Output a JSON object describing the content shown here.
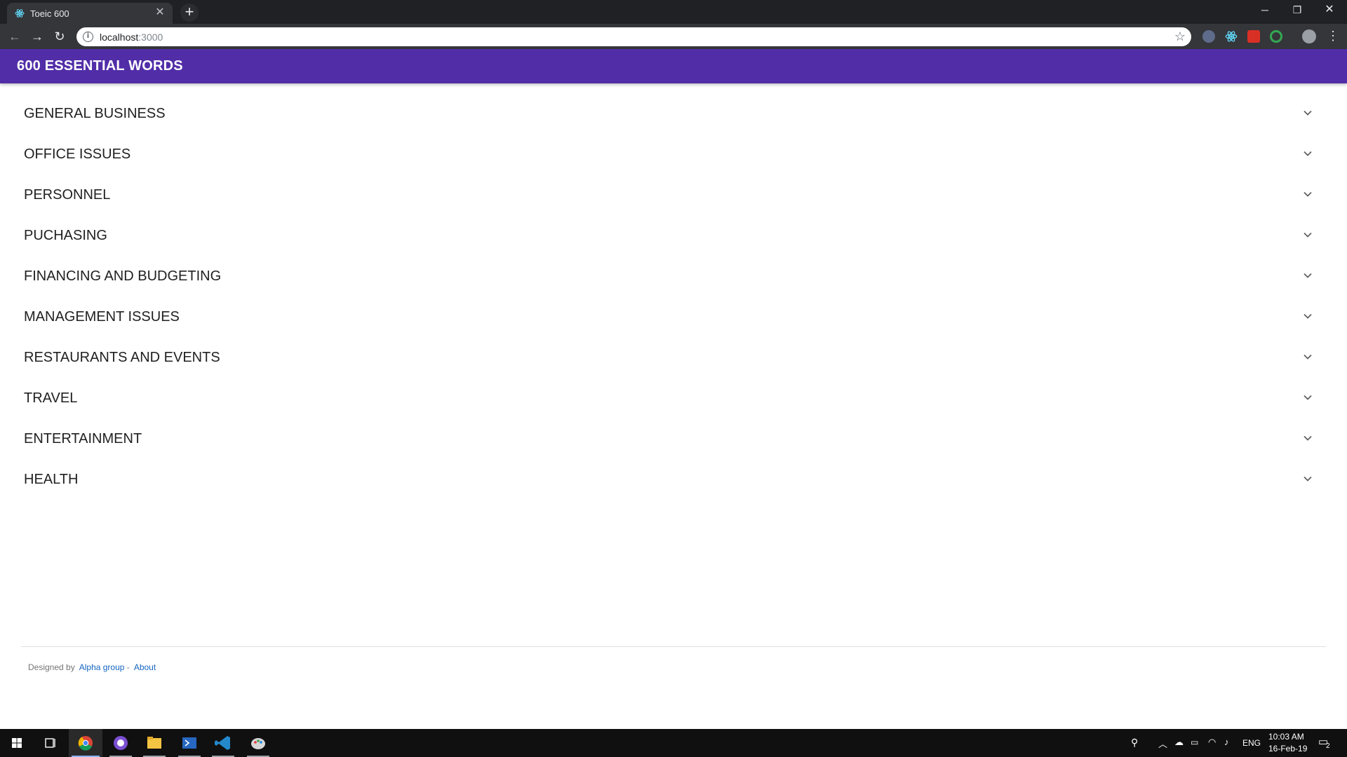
{
  "browser": {
    "tab_title": "Toeic 600",
    "url_host": "localhost",
    "url_port": ":3000"
  },
  "app": {
    "title": "600 ESSENTIAL WORDS",
    "accent_color": "#512da8"
  },
  "categories": [
    "GENERAL BUSINESS",
    "OFFICE ISSUES",
    "PERSONNEL",
    "PUCHASING",
    "FINANCING AND BUDGETING",
    "MANAGEMENT ISSUES",
    "RESTAURANTS AND EVENTS",
    "TRAVEL",
    "ENTERTAINMENT",
    "HEALTH"
  ],
  "footer": {
    "designed_by": "Designed by",
    "group_link": "Alpha group",
    "separator": "-",
    "about_link": "About"
  },
  "taskbar": {
    "language": "ENG",
    "time": "10:03 AM",
    "date": "16-Feb-19",
    "notification_count": "2"
  }
}
